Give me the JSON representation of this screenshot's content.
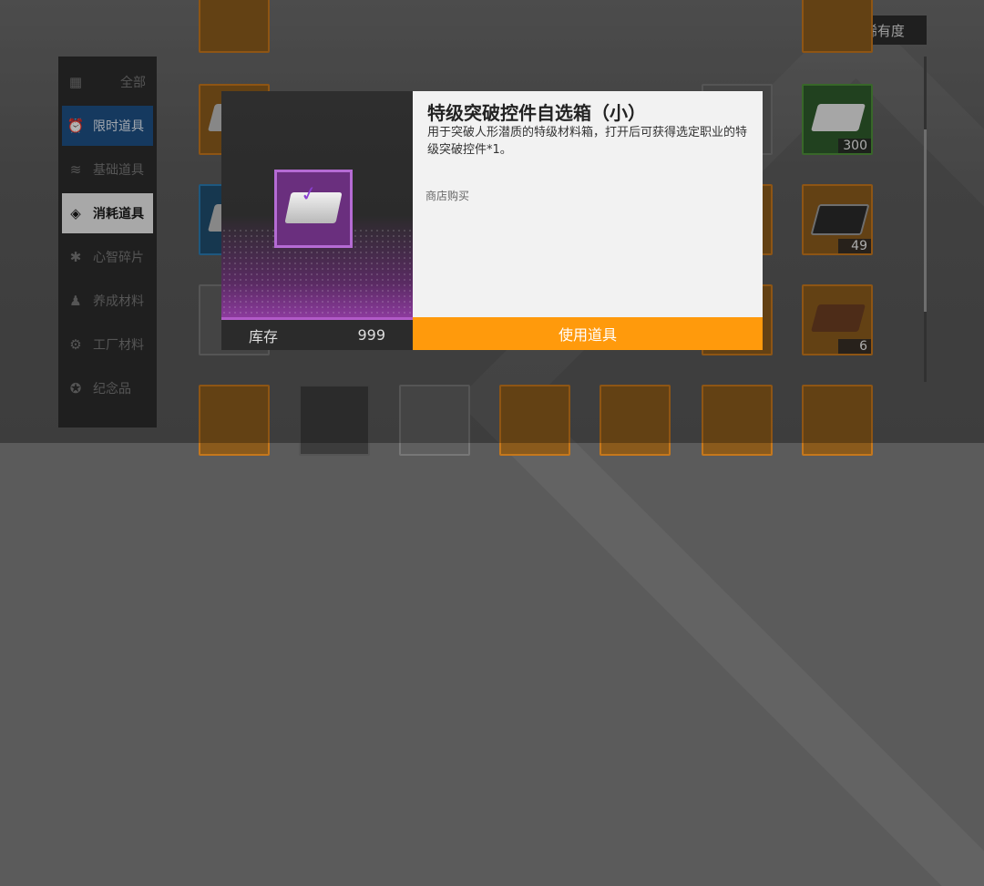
{
  "sort": {
    "label": "稀有度"
  },
  "sidebar": {
    "items": [
      {
        "label": "全部"
      },
      {
        "label": "限时道具"
      },
      {
        "label": "基础道具"
      },
      {
        "label": "消耗道具"
      },
      {
        "label": "心智碎片"
      },
      {
        "label": "养成材料"
      },
      {
        "label": "工厂材料"
      },
      {
        "label": "纪念品"
      }
    ]
  },
  "grid": {
    "counts": [
      "300",
      "49",
      "6"
    ]
  },
  "dialog": {
    "item_name": "特级突破控件自选箱（小）",
    "description": "用于突破人形潜质的特级材料箱，打开后可获得选定职业的特级突破控件*1。",
    "source": "商店购买",
    "stock_label": "库存",
    "stock_value": "999",
    "use_button": "使用道具"
  },
  "colors": {
    "accent": "#ff9a0c",
    "rarity_purple": "#b56bd4",
    "active_tab": "#1e4f84"
  }
}
